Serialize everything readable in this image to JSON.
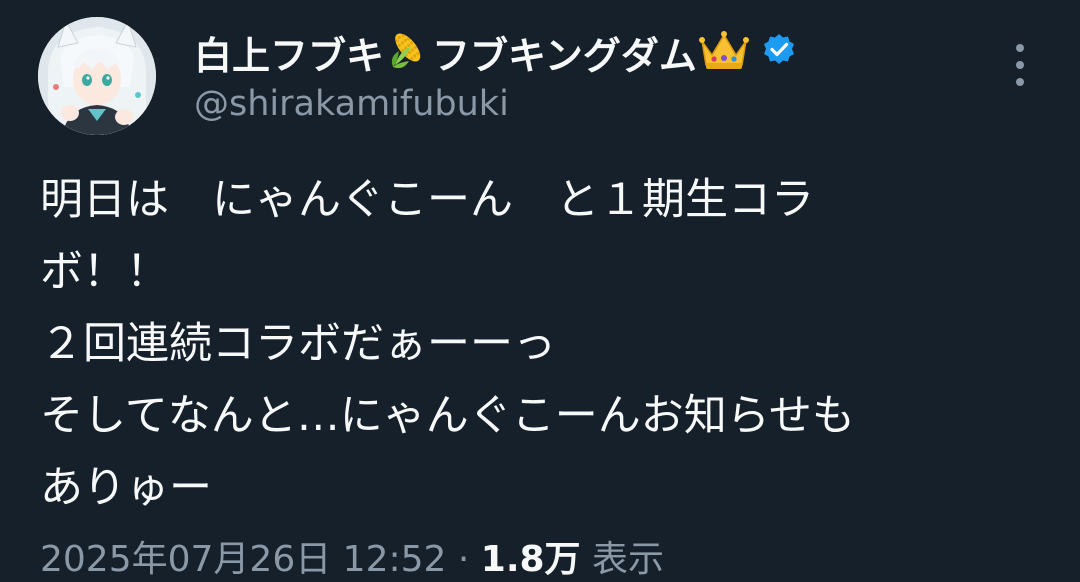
{
  "tweet": {
    "author": {
      "name_part1": "白上フブキ",
      "emoji_corn": "corn-emoji",
      "name_part2": "フブキングダム",
      "emoji_crown": "crown-emoji",
      "verified": true,
      "handle": "@shirakamifubuki"
    },
    "text_lines": [
      "明日は　にゃんぐこーん　と１期生コラ",
      "ボ！！",
      "２回連続コラボだぁーーっ",
      "そしてなんと…にゃんぐこーんお知らせも",
      "ありゅー"
    ],
    "meta": {
      "timestamp": "2025年07月26日 12:52",
      "separator": " · ",
      "views_count": "1.8万",
      "views_label": "表示"
    }
  },
  "colors": {
    "background": "#15202b",
    "primary_text": "#f7f9f9",
    "secondary_text": "#8b98a5",
    "verified_blue": "#1d9bf0"
  }
}
